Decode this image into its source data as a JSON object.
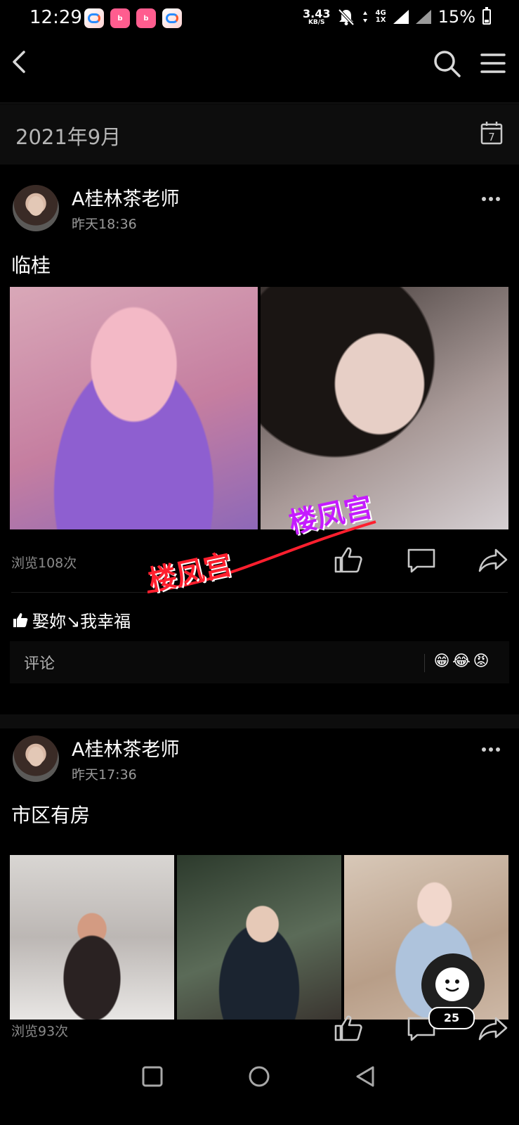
{
  "status_bar": {
    "time": "12:29",
    "net_speed": "3.43",
    "net_speed_unit": "KB/S",
    "net_type_top": "4G",
    "net_type_bottom": "1X",
    "battery": "15%"
  },
  "feed": {
    "month": "2021年9月",
    "calendar_day": "7"
  },
  "posts": [
    {
      "author": "A桂林茶老师",
      "time": "昨天18:36",
      "text": "临桂",
      "views": "浏览108次",
      "liked_by": "娶妳↘我幸福",
      "comment_placeholder": "评论",
      "reaction_emojis": [
        "😁",
        "😂",
        "😡"
      ]
    },
    {
      "author": "A桂林茶老师",
      "time": "昨天17:36",
      "text": "市区有房",
      "views": "浏览93次"
    }
  ],
  "watermarks": [
    "楼凤宫",
    "楼凤宫"
  ],
  "floating": {
    "badge": "25"
  },
  "colors": {
    "background": "#000000",
    "watermark_red": "#ff1f2e",
    "watermark_purple": "#c51bff"
  }
}
